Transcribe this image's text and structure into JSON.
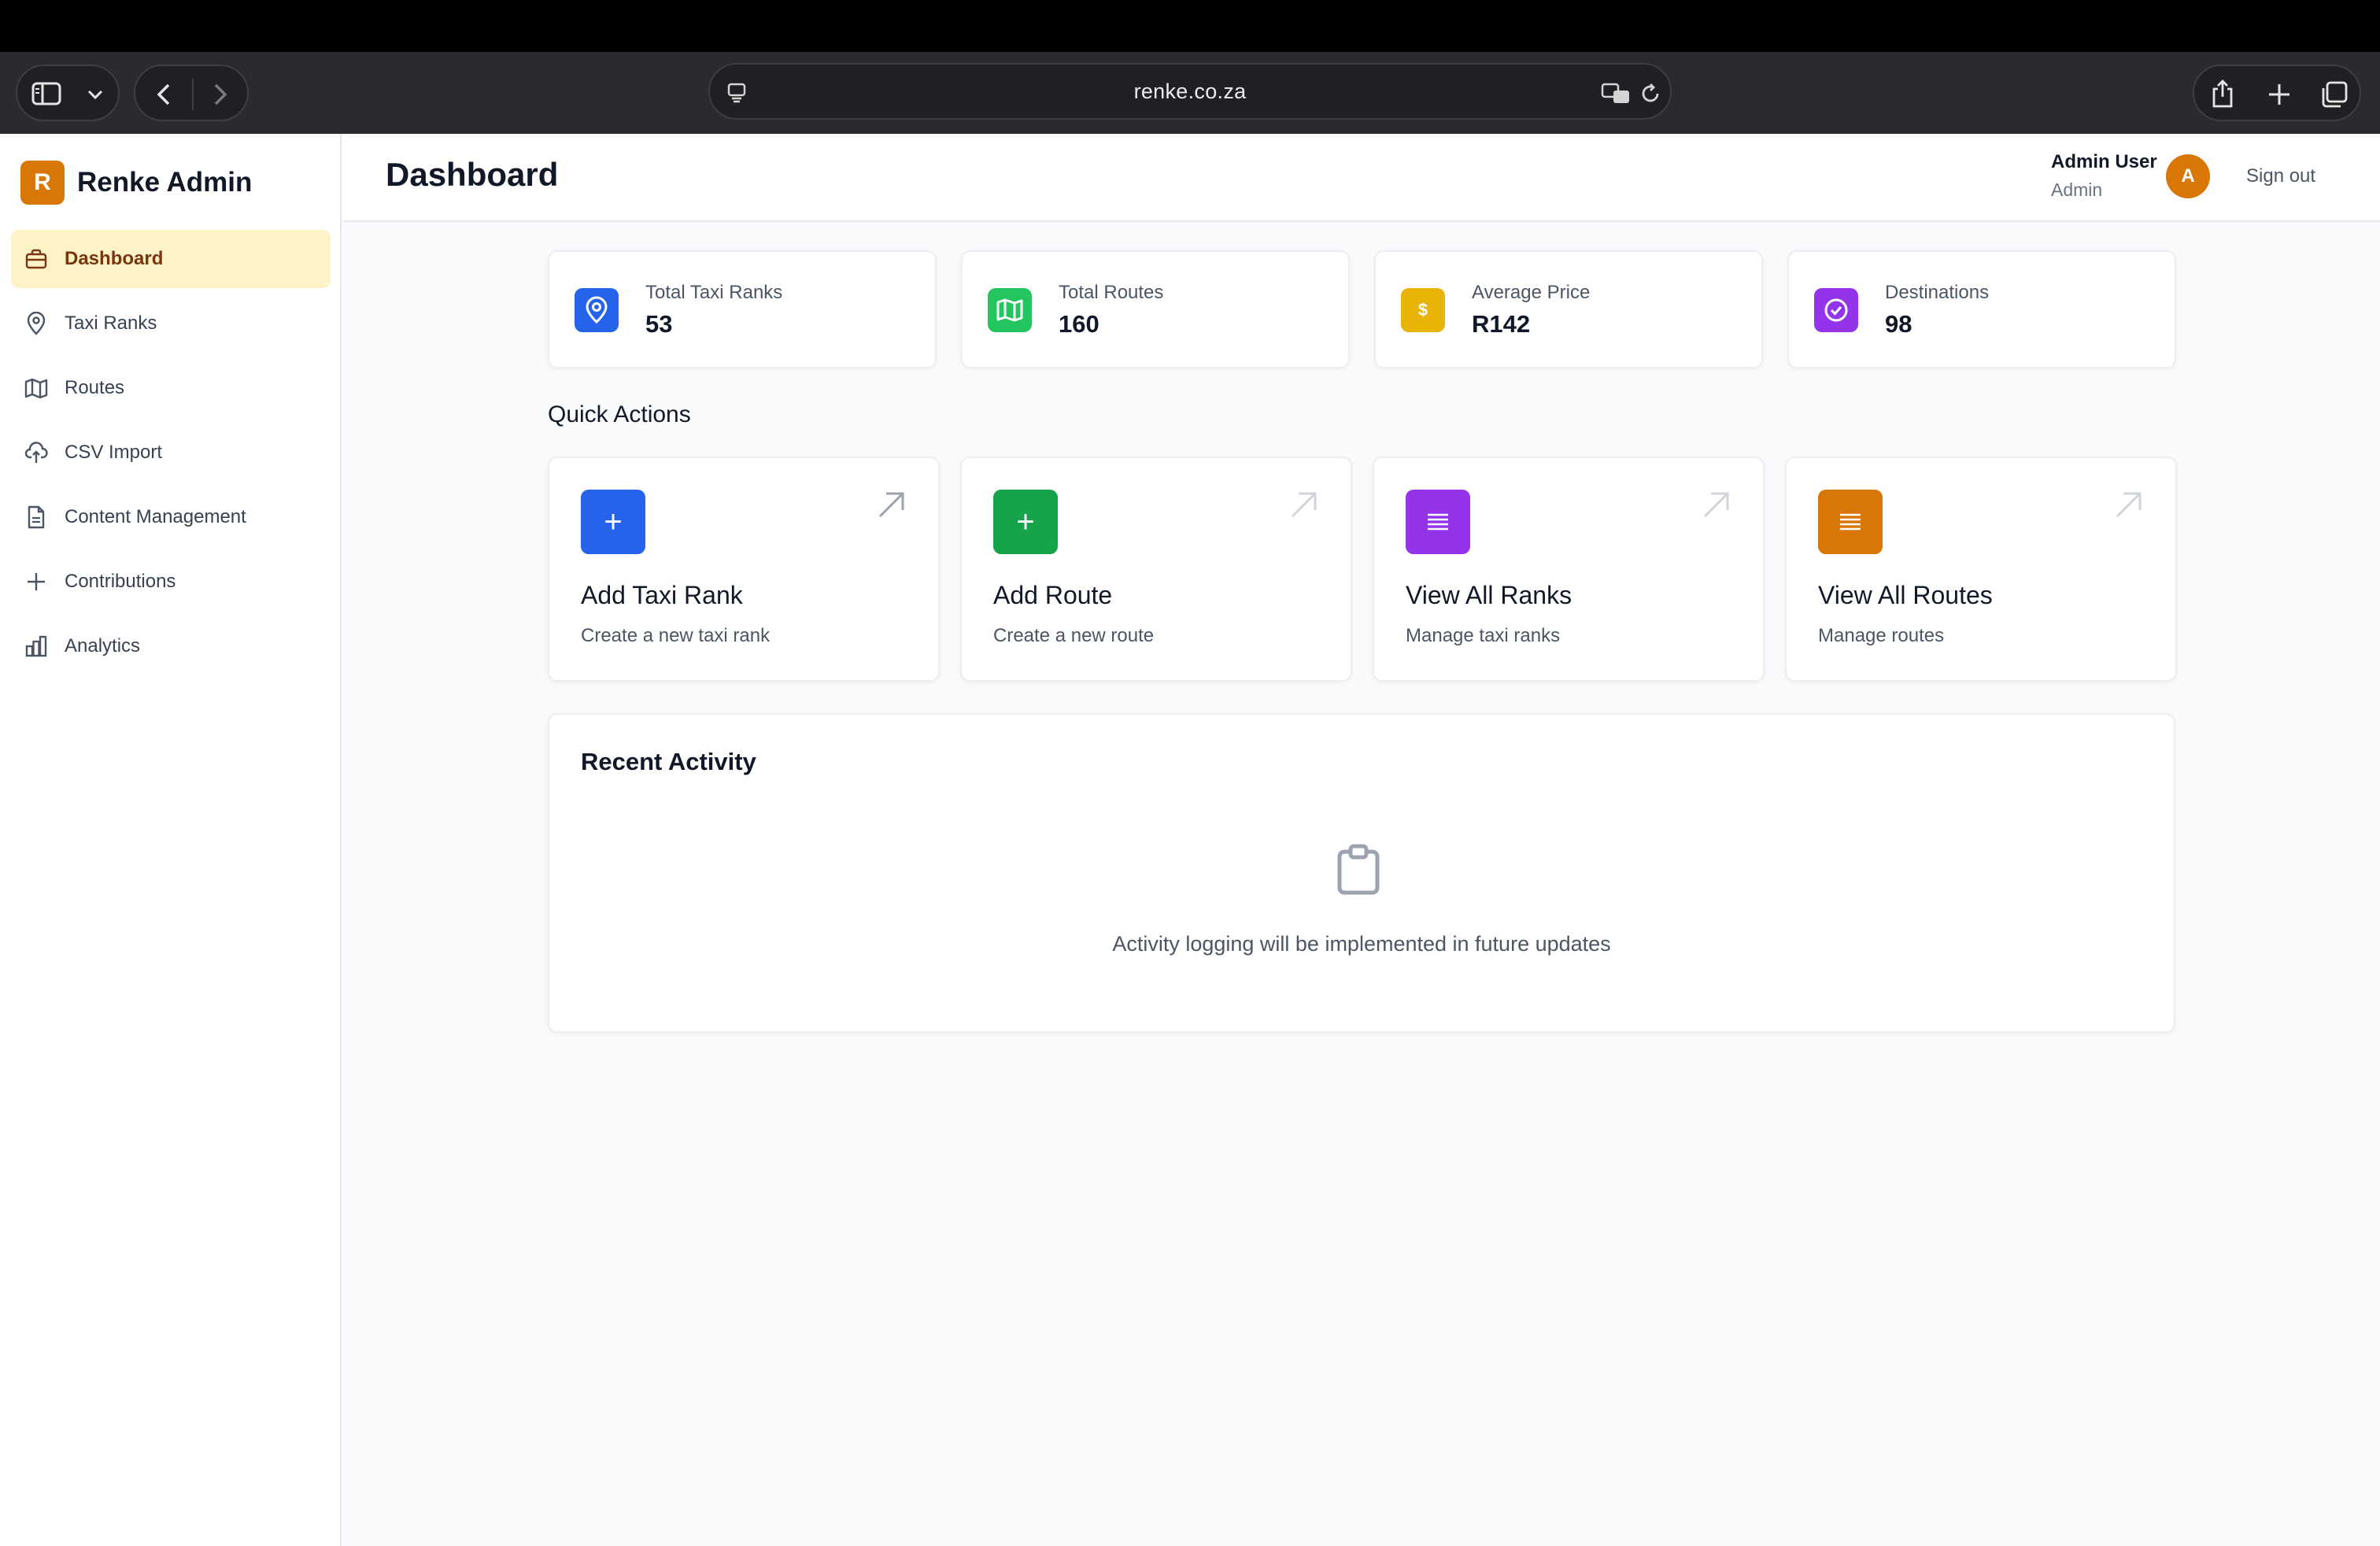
{
  "browser": {
    "url": "renke.co.za"
  },
  "brand": {
    "logo_letter": "R",
    "name": "Renke Admin",
    "accent_color": "#d97706"
  },
  "sidebar": {
    "items": [
      {
        "label": "Dashboard",
        "icon": "briefcase-icon",
        "active": true
      },
      {
        "label": "Taxi Ranks",
        "icon": "map-pin-icon"
      },
      {
        "label": "Routes",
        "icon": "map-icon"
      },
      {
        "label": "CSV Import",
        "icon": "cloud-upload-icon"
      },
      {
        "label": "Content Management",
        "icon": "document-icon"
      },
      {
        "label": "Contributions",
        "icon": "plus-icon"
      },
      {
        "label": "Analytics",
        "icon": "bar-chart-icon"
      }
    ]
  },
  "header": {
    "title": "Dashboard",
    "user_name": "Admin User",
    "user_role": "Admin",
    "avatar_letter": "A",
    "sign_out": "Sign out"
  },
  "stats": [
    {
      "label": "Total Taxi Ranks",
      "value": "53",
      "icon": "map-pin-icon",
      "color": "#2563eb"
    },
    {
      "label": "Total Routes",
      "value": "160",
      "icon": "map-icon",
      "color": "#22c55e"
    },
    {
      "label": "Average Price",
      "value": "R142",
      "icon": "dollar-icon",
      "icon_text": "$",
      "color": "#eab308"
    },
    {
      "label": "Destinations",
      "value": "98",
      "icon": "check-circle-icon",
      "color": "#9333ea"
    }
  ],
  "quick_actions": {
    "title": "Quick Actions",
    "items": [
      {
        "title": "Add Taxi Rank",
        "subtitle": "Create a new taxi rank",
        "icon": "plus-icon",
        "icon_text": "+",
        "color": "#2563eb"
      },
      {
        "title": "Add Route",
        "subtitle": "Create a new route",
        "icon": "plus-icon",
        "icon_text": "+",
        "color": "#16a34a"
      },
      {
        "title": "View All Ranks",
        "subtitle": "Manage taxi ranks",
        "icon": "list-icon",
        "color": "#9333ea"
      },
      {
        "title": "View All Routes",
        "subtitle": "Manage routes",
        "icon": "list-icon",
        "color": "#d97706"
      }
    ]
  },
  "recent_activity": {
    "title": "Recent Activity",
    "empty_message": "Activity logging will be implemented in future updates"
  }
}
